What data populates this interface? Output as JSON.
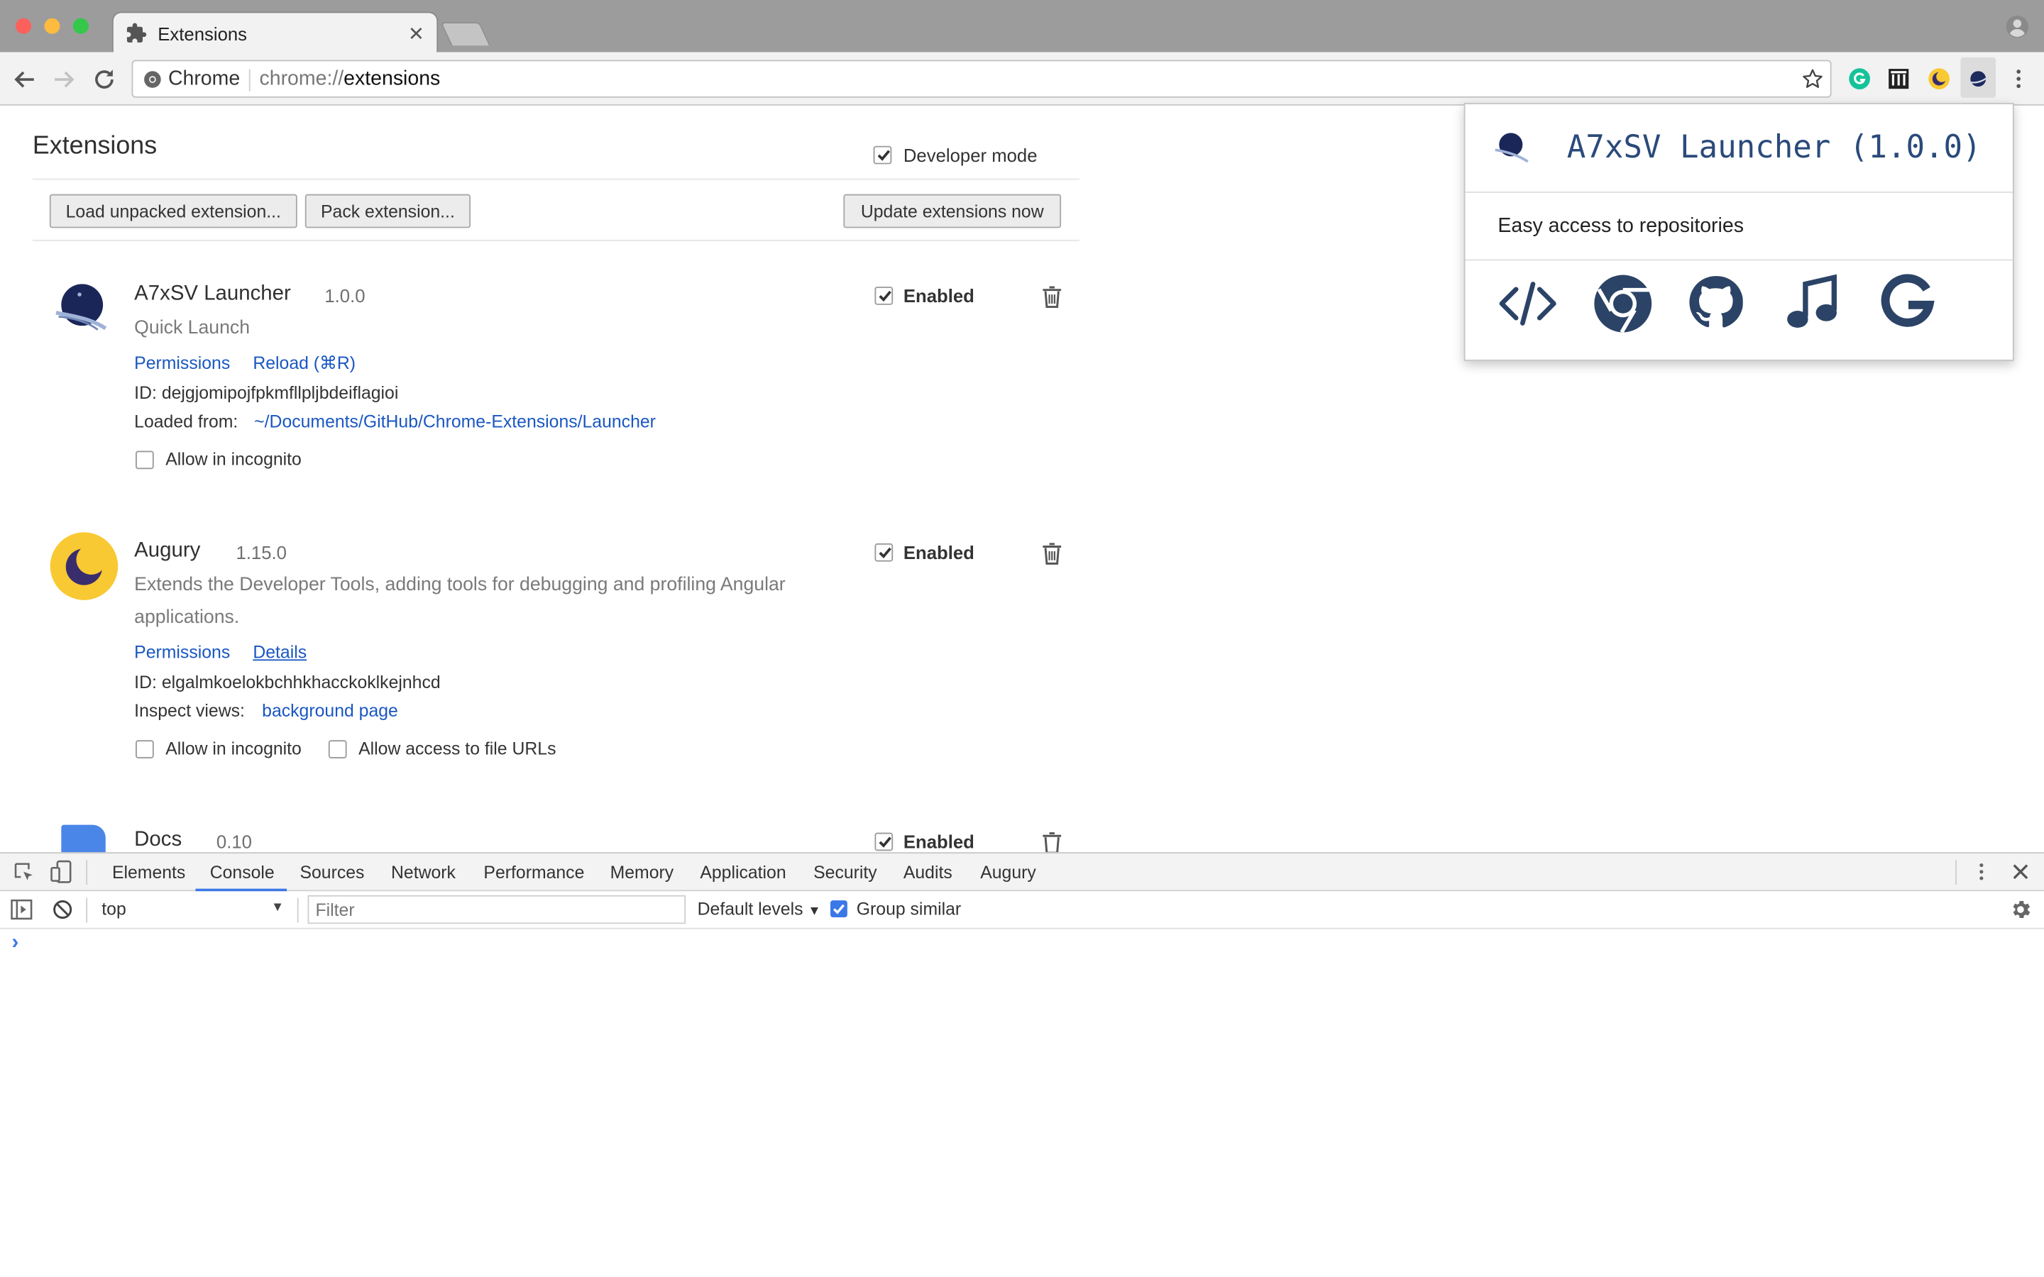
{
  "browser": {
    "tab_title": "Extensions",
    "omnibox_chip": "Chrome",
    "omnibox_url_scheme": "chrome://",
    "omnibox_url_host": "extensions",
    "colors": {
      "close": "#fc605c",
      "minimize": "#fdbc40",
      "maximize": "#34c84a"
    }
  },
  "page": {
    "title": "Extensions",
    "developer_mode_label": "Developer mode",
    "load_unpacked": "Load unpacked extension...",
    "pack_extension": "Pack extension...",
    "update_now": "Update extensions now"
  },
  "extensions": [
    {
      "name": "A7xSV Launcher",
      "version": "1.0.0",
      "description": "Quick Launch",
      "link_permissions": "Permissions",
      "link_reload": "Reload (⌘R)",
      "id_label": "ID:",
      "id_value": "dejgjomipojfpkmfllpljbdeiflagioi",
      "loaded_label": "Loaded from:",
      "loaded_path": "~/Documents/GitHub/Chrome-Extensions/Launcher",
      "enabled_label": "Enabled",
      "incognito_label": "Allow in incognito"
    },
    {
      "name": "Augury",
      "version": "1.15.0",
      "description_line1": "Extends the Developer Tools, adding tools for debugging and profiling Angular",
      "description_line2": "applications.",
      "link_permissions": "Permissions",
      "link_details": "Details",
      "id_label": "ID:",
      "id_value": "elgalmkoelokbchhkhacckoklkejnhcd",
      "inspect_label": "Inspect views:",
      "inspect_link": "background page",
      "enabled_label": "Enabled",
      "incognito_label": "Allow in incognito",
      "file_urls_label": "Allow access to file URLs"
    },
    {
      "name": "Docs",
      "version": "0.10",
      "enabled_label": "Enabled"
    }
  ],
  "popup": {
    "title": "A7xSV Launcher (1.0.0)",
    "subtitle": "Easy access to repositories",
    "icons": [
      "code-icon",
      "chrome-icon",
      "github-icon",
      "music-icon",
      "google-icon"
    ]
  },
  "devtools": {
    "tabs": [
      "Elements",
      "Console",
      "Sources",
      "Network",
      "Performance",
      "Memory",
      "Application",
      "Security",
      "Audits",
      "Augury"
    ],
    "active_tab": "Console",
    "context": "top",
    "filter_placeholder": "Filter",
    "levels": "Default levels",
    "group_similar": "Group similar",
    "prompt": "›",
    "accent": "#3b78e7"
  }
}
